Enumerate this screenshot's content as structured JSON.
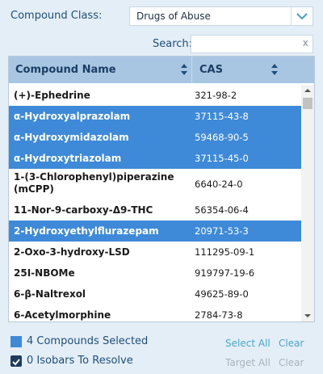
{
  "filter": {
    "class_label": "Compound Class:",
    "class_value": "Drugs of Abuse"
  },
  "search": {
    "label": "Search:",
    "value": "",
    "clear_glyph": "x"
  },
  "table": {
    "columns": [
      "Compound Name",
      "CAS"
    ],
    "rows": [
      {
        "name": "(+)-Ephedrine",
        "cas": "321-98-2",
        "selected": false
      },
      {
        "name": "α-Hydroxyalprazolam",
        "cas": "37115-43-8",
        "selected": true
      },
      {
        "name": "α-Hydroxymidazolam",
        "cas": "59468-90-5",
        "selected": true
      },
      {
        "name": "α-Hydroxytriazolam",
        "cas": "37115-45-0",
        "selected": true
      },
      {
        "name": "1-(3-Chlorophenyl)piperazine (mCPP)",
        "cas": "6640-24-0",
        "selected": false
      },
      {
        "name": "11-Nor-9-carboxy-Δ9-THC",
        "cas": "56354-06-4",
        "selected": false
      },
      {
        "name": "2-Hydroxyethylflurazepam",
        "cas": "20971-53-3",
        "selected": true
      },
      {
        "name": "2-Oxo-3-hydroxy-LSD",
        "cas": "111295-09-1",
        "selected": false
      },
      {
        "name": "25I-NBOMe",
        "cas": "919797-19-6",
        "selected": false
      },
      {
        "name": "6-β-Naltrexol",
        "cas": "49625-89-0",
        "selected": false
      },
      {
        "name": "6-Acetylmorphine",
        "cas": "2784-73-8",
        "selected": false
      }
    ]
  },
  "footer": {
    "selected_text": "4 Compounds Selected",
    "isobars_text": "0 Isobars To Resolve",
    "select_all": "Select All",
    "clear1": "Clear",
    "target_all": "Target All",
    "clear2": "Clear"
  },
  "colors": {
    "selected_row": "#3e8ad8",
    "header": "#a8c6e2",
    "background": "#e4eef7",
    "link": "#49a6c9"
  },
  "icons": {
    "class_dropdown": "chevron-down-icon",
    "sort": "sort-arrows-icon",
    "search_clear": "close-icon"
  }
}
